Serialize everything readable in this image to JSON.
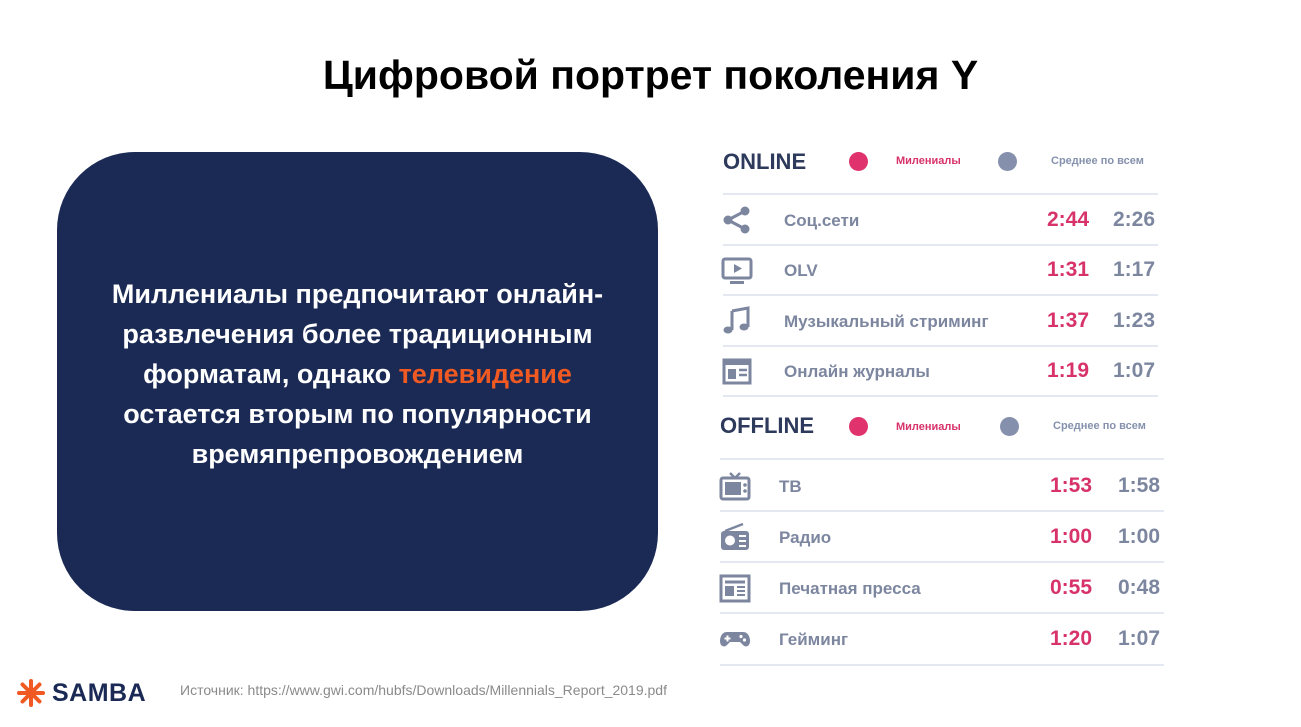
{
  "title": "Цифровой портрет поколения Y",
  "callout": {
    "text_before": "Миллениалы предпочитают онлайн-развлечения более традиционным форматам, однако ",
    "highlight": "телевидение",
    "text_after": " остается вторым по популярности времяпрепровождением"
  },
  "online": {
    "title": "ONLINE",
    "legend_millennials": "Милениалы",
    "legend_average": "Среднее по всем",
    "rows": [
      {
        "icon": "share-icon",
        "label": "Соц.сети",
        "millennials": "2:44",
        "average": "2:26"
      },
      {
        "icon": "video-icon",
        "label": "OLV",
        "millennials": "1:31",
        "average": "1:17"
      },
      {
        "icon": "music-note-icon",
        "label": "Музыкальный стриминг",
        "millennials": "1:37",
        "average": "1:23"
      },
      {
        "icon": "magazine-icon",
        "label": "Онлайн журналы",
        "millennials": "1:19",
        "average": "1:07"
      }
    ]
  },
  "offline": {
    "title": "OFFLINE",
    "legend_millennials": "Милениалы",
    "legend_average": "Среднее по всем",
    "rows": [
      {
        "icon": "tv-icon",
        "label": "ТВ",
        "millennials": "1:53",
        "average": "1:58"
      },
      {
        "icon": "radio-icon",
        "label": "Радио",
        "millennials": "1:00",
        "average": "1:00"
      },
      {
        "icon": "newspaper-icon",
        "label": "Печатная пресса",
        "millennials": "0:55",
        "average": "0:48"
      },
      {
        "icon": "gamepad-icon",
        "label": "Гейминг",
        "millennials": "1:20",
        "average": "1:07"
      }
    ]
  },
  "footer": {
    "brand": "SAMBA",
    "source": "Источник: https://www.gwi.com/hubfs/Downloads/Millennials_Report_2019.pdf"
  },
  "colors": {
    "navy": "#1b2a55",
    "accent_orange": "#f05a22",
    "millennials_pink": "#d7336a",
    "average_grey": "#7c869f"
  }
}
